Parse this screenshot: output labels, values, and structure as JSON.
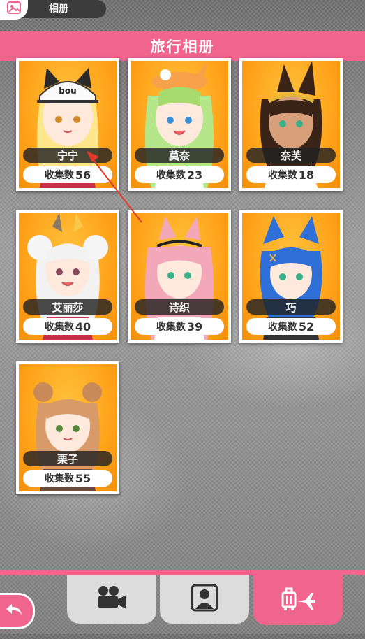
{
  "top_bar": {
    "title": "相册",
    "icon": "album-icon"
  },
  "header": {
    "title": "旅行相册"
  },
  "count_label": "收集数",
  "cards": [
    {
      "name": "宁宁",
      "count": "56",
      "portrait": "character-ningning-portrait"
    },
    {
      "name": "莫奈",
      "count": "23",
      "portrait": "character-monai-portrait"
    },
    {
      "name": "奈芙",
      "count": "18",
      "portrait": "character-naifu-portrait"
    },
    {
      "name": "艾丽莎",
      "count": "40",
      "portrait": "character-alisha-portrait"
    },
    {
      "name": "诗织",
      "count": "39",
      "portrait": "character-shiori-portrait"
    },
    {
      "name": "巧",
      "count": "52",
      "portrait": "character-qiao-portrait"
    },
    {
      "name": "栗子",
      "count": "55",
      "portrait": "character-lizi-portrait"
    }
  ],
  "bottom_nav": {
    "tabs": [
      {
        "icon": "video-camera-icon",
        "active": false
      },
      {
        "icon": "person-icon",
        "active": false
      },
      {
        "icon": "travel-luggage-plane-icon",
        "active": true
      }
    ],
    "back_icon": "back-arrow-icon"
  },
  "colors": {
    "accent": "#f0648e",
    "card_bg": "#ffa41b",
    "name_pill": "#222222"
  }
}
